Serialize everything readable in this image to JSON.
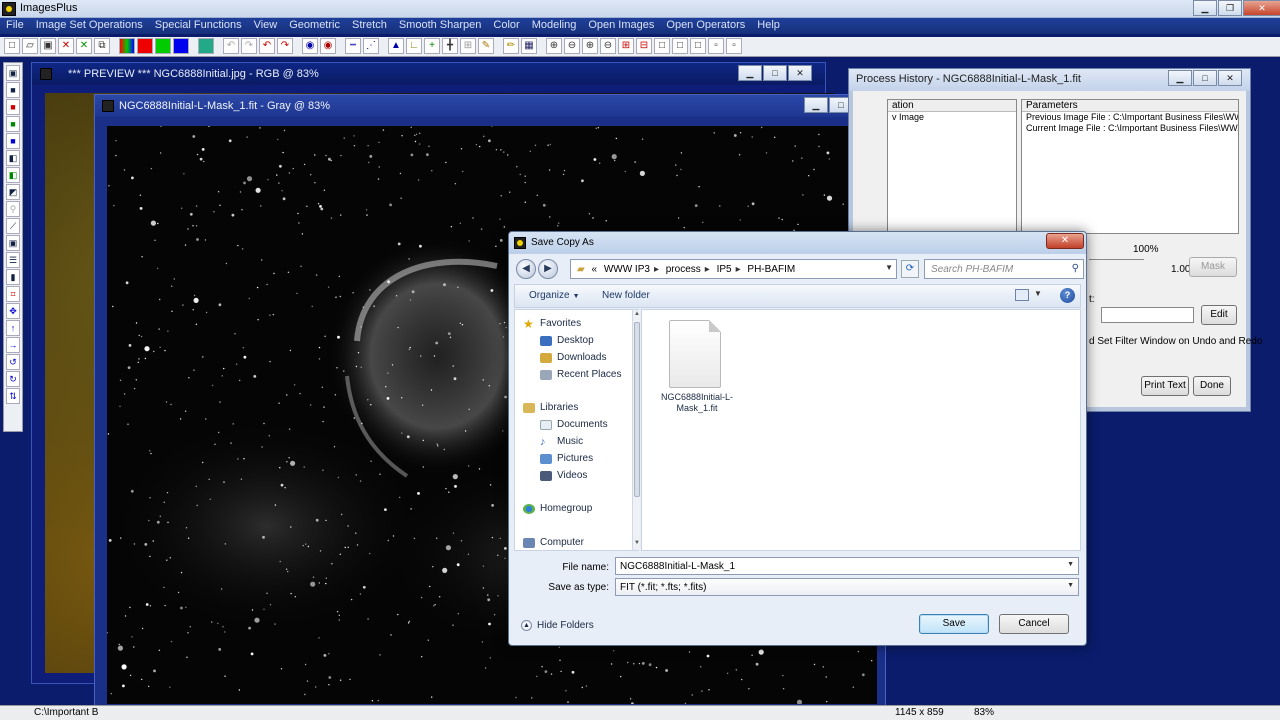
{
  "app": {
    "title": "ImagesPlus",
    "menu": [
      "File",
      "Image Set Operations",
      "Special Functions",
      "View",
      "Geometric",
      "Stretch",
      "Smooth Sharpen",
      "Color",
      "Modeling",
      "Open Images",
      "Open Operators",
      "Help"
    ]
  },
  "preview_window": {
    "title": "*** PREVIEW *** NGC6888Initial.jpg - RGB @ 83%"
  },
  "gray_window": {
    "title": "NGC6888Initial-L-Mask_1.fit - Gray @ 83%"
  },
  "history": {
    "title": "Process History - NGC6888Initial-L-Mask_1.fit",
    "col_operation_partial": "ation",
    "row_operation_partial": "v Image",
    "col_parameters": "Parameters",
    "params": [
      "Previous Image File : C:\\Important Business Files\\WW...",
      "Current Image File : C:\\Important Business Files\\WW..."
    ],
    "percent": "100%",
    "value": "1.000",
    "mask_button": "Mask",
    "edit_button": "Edit",
    "colon_text": "t:",
    "filter_note": "d Set Filter Window on Undo and Redo",
    "print_button": "Print Text",
    "done_button": "Done"
  },
  "status": {
    "path": "C:\\Important B",
    "size": "1145 x 859",
    "zoom": "83%"
  },
  "dialog": {
    "title": "Save Copy As",
    "breadcrumb": [
      "WWW IP3",
      "process",
      "IP5",
      "PH-BAFIM"
    ],
    "breadcrumb_prefix": "«",
    "search_placeholder": "Search PH-BAFIM",
    "organize": "Organize",
    "new_folder": "New folder",
    "nav": {
      "favorites": "Favorites",
      "favorite_items": [
        "Desktop",
        "Downloads",
        "Recent Places"
      ],
      "libraries": "Libraries",
      "library_items": [
        "Documents",
        "Music",
        "Pictures",
        "Videos"
      ],
      "homegroup": "Homegroup",
      "computer": "Computer"
    },
    "file": {
      "name": "NGC6888Initial-L-Mask_1.fit"
    },
    "file_name_label": "File name:",
    "file_name_value": "NGC6888Initial-L-Mask_1",
    "save_type_label": "Save as type:",
    "save_type_value": "FIT (*.fit; *.fts; *.fits)",
    "hide_folders": "Hide Folders",
    "save_button": "Save",
    "cancel_button": "Cancel"
  }
}
